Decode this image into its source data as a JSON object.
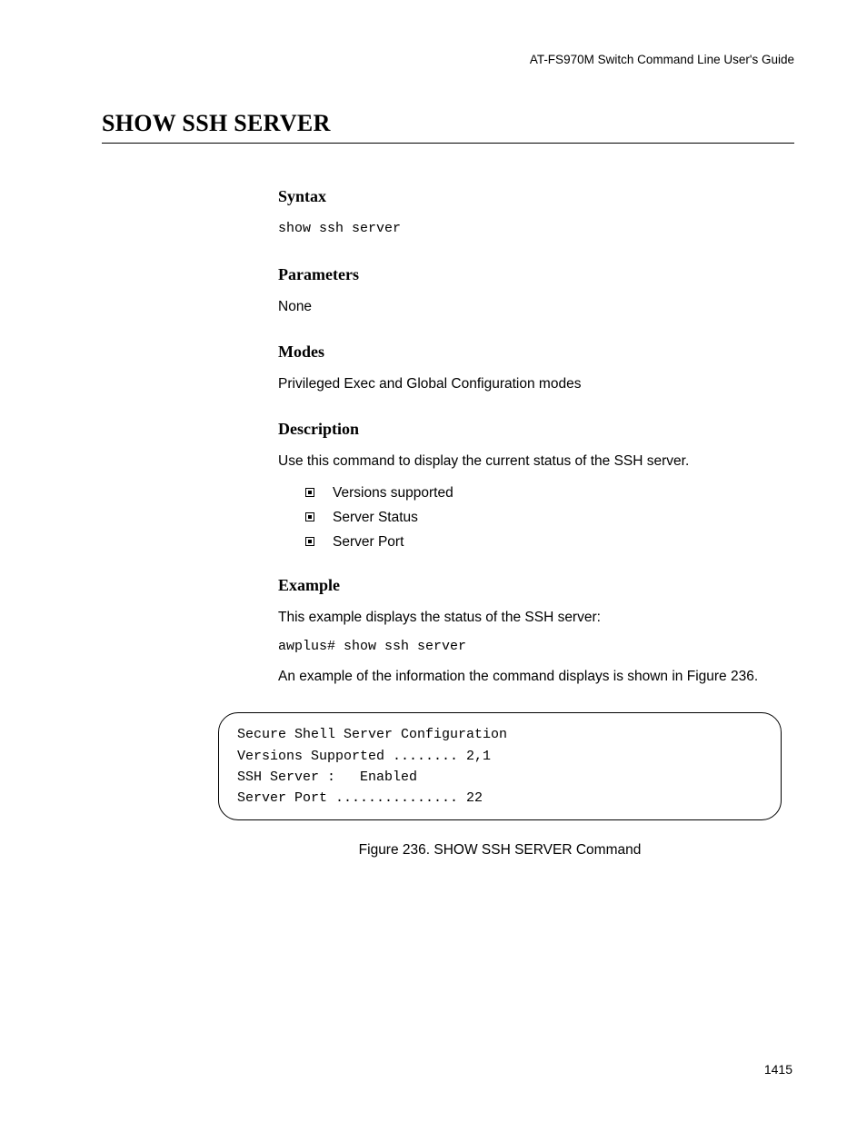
{
  "header": {
    "doc_title": "AT-FS970M Switch Command Line User's Guide"
  },
  "title": "SHOW SSH SERVER",
  "sections": {
    "syntax": {
      "head": "Syntax",
      "command": "show ssh server"
    },
    "parameters": {
      "head": "Parameters",
      "text": "None"
    },
    "modes": {
      "head": "Modes",
      "text": "Privileged Exec and Global Configuration modes"
    },
    "description": {
      "head": "Description",
      "intro": "Use this command to display the current status of the SSH server.",
      "bullets": [
        "Versions supported",
        "Server Status",
        "Server Port"
      ]
    },
    "example": {
      "head": "Example",
      "intro": "This example displays the status of the SSH server:",
      "command": "awplus# show ssh server",
      "outro": "An example of the information the command displays is shown in Figure 236."
    }
  },
  "figure": {
    "lines": [
      "Secure Shell Server Configuration",
      "Versions Supported ........ 2,1",
      "SSH Server :   Enabled",
      "Server Port ............... 22"
    ],
    "caption": "Figure 236. SHOW SSH SERVER Command"
  },
  "page_number": "1415"
}
